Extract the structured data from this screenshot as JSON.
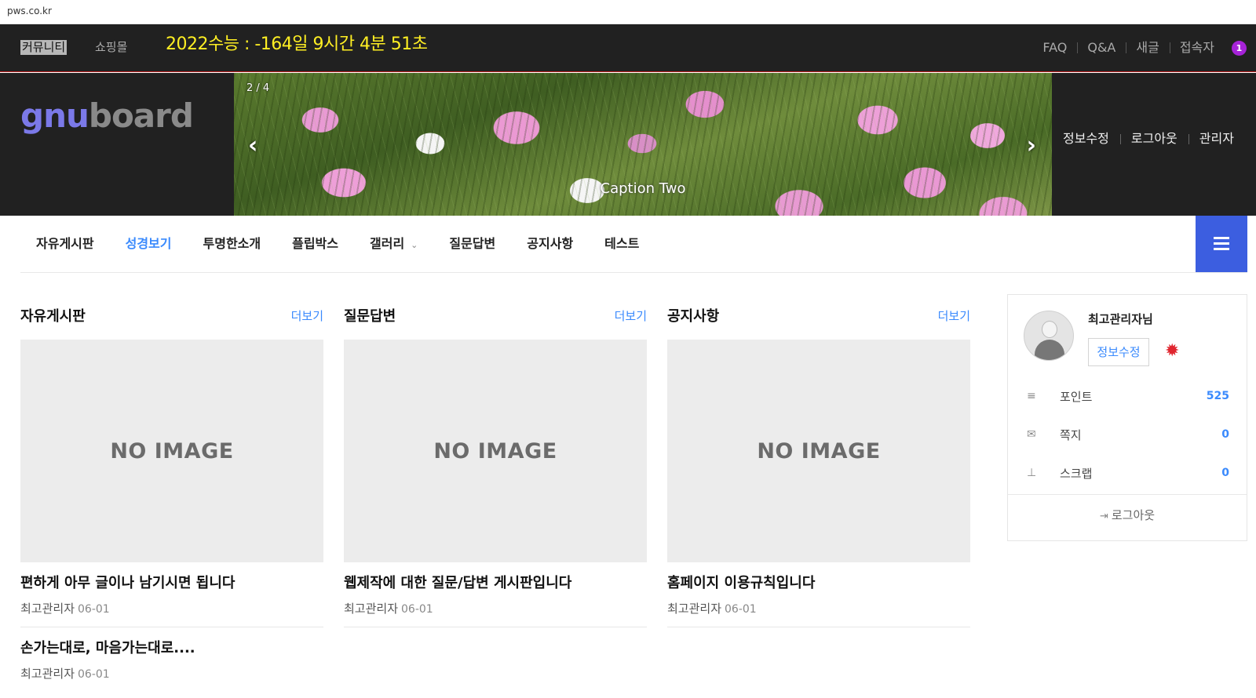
{
  "browser": {
    "url": "pws.co.kr"
  },
  "topbar": {
    "tab_community": "커뮤니티",
    "tab_shop": "쇼핑몰",
    "countdown": "2022수능 : -164일 9시간 4분 51초",
    "links": {
      "faq": "FAQ",
      "qna": "Q&A",
      "new": "새글",
      "visitors": "접속자"
    },
    "visitor_count": "1"
  },
  "header": {
    "logo_part1": "gnu",
    "logo_part2": "board",
    "slider": {
      "counter": "2 / 4",
      "caption": "Caption Two",
      "prev": "‹",
      "next": "›"
    },
    "user_links": {
      "edit": "정보수정",
      "logout": "로그아웃",
      "admin": "관리자"
    }
  },
  "nav": {
    "items": [
      "자유게시판",
      "성경보기",
      "투명한소개",
      "플립박스",
      "갤러리",
      "질문답변",
      "공지사항",
      "테스트"
    ],
    "active": "성경보기",
    "dropdown_indicator": "⌄"
  },
  "boards": [
    {
      "title": "자유게시판",
      "more": "더보기",
      "thumb": "NO IMAGE",
      "posts": [
        {
          "title": "편하게 아무 글이나 남기시면 됩니다",
          "author": "최고관리자",
          "date": "06-01"
        },
        {
          "title": "손가는대로, 마음가는대로....",
          "author": "최고관리자",
          "date": "06-01"
        }
      ]
    },
    {
      "title": "질문답변",
      "more": "더보기",
      "thumb": "NO IMAGE",
      "posts": [
        {
          "title": "웹제작에 대한 질문/답변 게시판입니다",
          "author": "최고관리자",
          "date": "06-01"
        }
      ]
    },
    {
      "title": "공지사항",
      "more": "더보기",
      "thumb": "NO IMAGE",
      "posts": [
        {
          "title": "홈페이지 이용규칙입니다",
          "author": "최고관리자",
          "date": "06-01"
        }
      ]
    }
  ],
  "profile": {
    "name": "최고관리자님",
    "edit_button": "정보수정",
    "rows": [
      {
        "icon": "database-icon",
        "label": "포인트",
        "value": "525"
      },
      {
        "icon": "envelope-icon",
        "label": "쪽지",
        "value": "0"
      },
      {
        "icon": "pin-icon",
        "label": "스크랩",
        "value": "0"
      }
    ],
    "logout": "로그아웃"
  },
  "colors": {
    "accent": "#3a8afd",
    "countdown": "#ffef23",
    "menu_button": "#3c5ee0",
    "badge": "#a623d8",
    "gear": "#e0262f"
  }
}
